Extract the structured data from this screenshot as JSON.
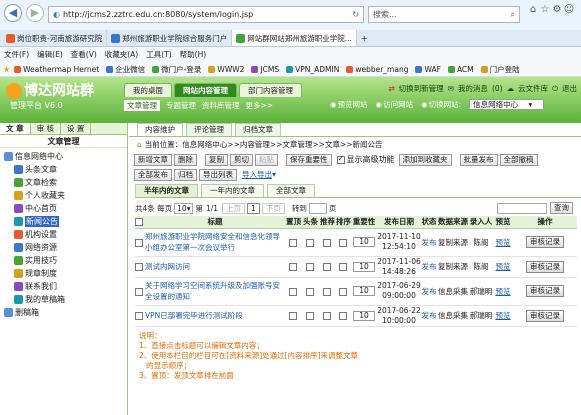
{
  "browser": {
    "url": "http://jcms2.zztrc.edu.cn:8080/system/login.jsp",
    "search_placeholder": "搜索...",
    "tabs": [
      {
        "label": "岗位职责-河南旅游研究院",
        "active": false
      },
      {
        "label": "郑州旅游职业学院综合服务门户",
        "active": false
      },
      {
        "label": "网站群网站郑州旅游职业学院...",
        "active": true
      }
    ],
    "menu": [
      "文件(F)",
      "编辑(E)",
      "查看(V)",
      "收藏夹(A)",
      "工具(T)",
      "帮助(H)"
    ],
    "favorites": [
      "Weathermap Hernet",
      "企业微信",
      "微门户-登录",
      "WWW2",
      "JCMS",
      "VPN_ADMIN",
      "webber_mang",
      "WAF",
      "ACM",
      "门户登陆"
    ]
  },
  "app": {
    "logo": "博达网站群",
    "system_name": "管理平台  V6.0",
    "main_tabs": [
      {
        "label": "我的桌面",
        "active": false
      },
      {
        "label": "网站内容管理",
        "active": true
      },
      {
        "label": "部门内容管理",
        "active": false
      }
    ],
    "header_links": [
      "切换到新管理",
      "我的消息",
      "云文件库",
      "退出"
    ],
    "message_count": "(0)",
    "subnav": [
      {
        "label": "文章管理",
        "active": true
      },
      {
        "label": "专题管理",
        "active": false
      },
      {
        "label": "资料库管理",
        "active": false
      },
      {
        "label": "更多>>",
        "active": false
      }
    ],
    "header_links2": [
      "预览网站",
      "访问网站",
      "切换网站:"
    ],
    "site_selected": "信息网络中心"
  },
  "left": {
    "tabs": [
      {
        "label": "文 章",
        "active": true
      },
      {
        "label": "审 核",
        "active": false
      },
      {
        "label": "设 置",
        "active": false
      }
    ],
    "title": "文章管理",
    "tree": [
      {
        "label": "信息网络中心",
        "level": 0,
        "selected": false
      },
      {
        "label": "头条文章",
        "level": 1,
        "selected": false
      },
      {
        "label": "文章检索",
        "level": 1,
        "selected": false
      },
      {
        "label": "个人收藏夹",
        "level": 1,
        "selected": false
      },
      {
        "label": "中心首页",
        "level": 1,
        "selected": false
      },
      {
        "label": "新闻公告",
        "level": 1,
        "selected": true
      },
      {
        "label": "机构设置",
        "level": 1,
        "selected": false
      },
      {
        "label": "网络资源",
        "level": 1,
        "selected": false
      },
      {
        "label": "实用技巧",
        "level": 1,
        "selected": false
      },
      {
        "label": "规章制度",
        "level": 1,
        "selected": false
      },
      {
        "label": "联系我们",
        "level": 1,
        "selected": false
      },
      {
        "label": "我的草稿箱",
        "level": 1,
        "selected": false
      },
      {
        "label": "删稿箱",
        "level": 0,
        "selected": false
      }
    ]
  },
  "right": {
    "tabs": [
      {
        "label": "内容维护",
        "active": true
      },
      {
        "label": "评论管理",
        "active": false
      },
      {
        "label": "归档文章",
        "active": false
      }
    ],
    "breadcrumb": "当前位置：信息网络中心>>内容管理>>文章管理>>文章>>新闻公告",
    "toolbar1": [
      {
        "label": "新增文章",
        "disabled": false
      },
      {
        "label": "删除",
        "disabled": false
      },
      {
        "sep": true
      },
      {
        "label": "复制",
        "disabled": false
      },
      {
        "label": "剪切",
        "disabled": false
      },
      {
        "label": "粘贴",
        "disabled": true
      },
      {
        "sep": true
      },
      {
        "label": "保存重要性",
        "disabled": false
      }
    ],
    "show_advanced_label": "显示高级功能",
    "toolbar1b": [
      {
        "label": "添加到收藏夹",
        "disabled": false
      },
      {
        "sep": true
      },
      {
        "label": "批量发布",
        "disabled": false
      },
      {
        "label": "全部撤稿",
        "disabled": false
      }
    ],
    "toolbar2": [
      {
        "label": "全部发布",
        "disabled": false
      },
      {
        "label": "归档",
        "disabled": false
      },
      {
        "label": "导出列表",
        "disabled": false
      }
    ],
    "import_export_label": "导入导出",
    "time_tabs": [
      {
        "label": "半年内的文章",
        "active": true
      },
      {
        "label": "一年内的文章",
        "active": false
      },
      {
        "label": "全部文章",
        "active": false
      }
    ],
    "pager": {
      "total_text": "共4条  每页",
      "per_page": "10",
      "page_text": "第",
      "page_of": "1/1",
      "buttons": [
        "上页",
        "1",
        "下页"
      ],
      "goto_label": "转到",
      "page_unit": "页",
      "query_button": "查询"
    },
    "columns": [
      "标题",
      "置顶",
      "头条",
      "推荐",
      "排序",
      "重要性",
      "发布日期",
      "状态",
      "数据来源",
      "录入人",
      "预览",
      "操作"
    ],
    "rows": [
      {
        "title": "郑州旅游职业学院网络安全和信息化领导小组办公室第一次会议举行",
        "red": false,
        "importance": "10",
        "date": "2017-11-10",
        "time": "12:54:10",
        "status": "发布",
        "source": "复制来源",
        "author": "陈阁",
        "preview": "预览",
        "action": "审核记录"
      },
      {
        "title": "测试内网访问",
        "red": false,
        "importance": "10",
        "date": "2017-11-06",
        "time": "14:48:26",
        "status": "发布",
        "source": "复制来源",
        "author": "陈阁",
        "preview": "预览",
        "action": "审核记录"
      },
      {
        "title": "关于网络学习空间系统升级及加强账号安全设置的通知",
        "red": false,
        "importance": "10",
        "date": "2017-06-29",
        "time": "09:00:00",
        "status": "发布",
        "source": "信息采集",
        "author": "郝瑞明",
        "preview": "预览",
        "action": "审核记录"
      },
      {
        "title": "VPN已部署完毕进行测试阶段",
        "red": false,
        "importance": "10",
        "date": "2017-06-22",
        "time": "10:00:00",
        "status": "发布",
        "source": "信息采集",
        "author": "郝瑞明",
        "preview": "预览",
        "action": "审核记录"
      }
    ],
    "notes": [
      "说明：",
      "1、直接点击标题可以编辑文章内容；",
      "2、使用本栏目的栏目可在[资料来源]处通过[内容排序]来调整文章",
      "   的显示顺序；",
      "3、置顶：发顶文章排在前面"
    ]
  }
}
